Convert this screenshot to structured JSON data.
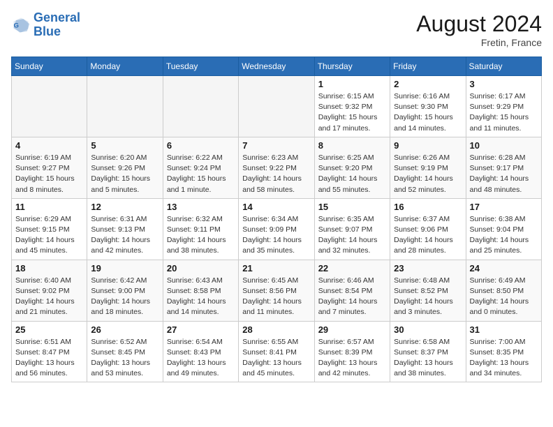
{
  "logo": {
    "text_general": "General",
    "text_blue": "Blue"
  },
  "header": {
    "month": "August 2024",
    "location": "Fretin, France"
  },
  "days_of_week": [
    "Sunday",
    "Monday",
    "Tuesday",
    "Wednesday",
    "Thursday",
    "Friday",
    "Saturday"
  ],
  "weeks": [
    [
      {
        "day": "",
        "info": ""
      },
      {
        "day": "",
        "info": ""
      },
      {
        "day": "",
        "info": ""
      },
      {
        "day": "",
        "info": ""
      },
      {
        "day": "1",
        "info": "Sunrise: 6:15 AM\nSunset: 9:32 PM\nDaylight: 15 hours and 17 minutes."
      },
      {
        "day": "2",
        "info": "Sunrise: 6:16 AM\nSunset: 9:30 PM\nDaylight: 15 hours and 14 minutes."
      },
      {
        "day": "3",
        "info": "Sunrise: 6:17 AM\nSunset: 9:29 PM\nDaylight: 15 hours and 11 minutes."
      }
    ],
    [
      {
        "day": "4",
        "info": "Sunrise: 6:19 AM\nSunset: 9:27 PM\nDaylight: 15 hours and 8 minutes."
      },
      {
        "day": "5",
        "info": "Sunrise: 6:20 AM\nSunset: 9:26 PM\nDaylight: 15 hours and 5 minutes."
      },
      {
        "day": "6",
        "info": "Sunrise: 6:22 AM\nSunset: 9:24 PM\nDaylight: 15 hours and 1 minute."
      },
      {
        "day": "7",
        "info": "Sunrise: 6:23 AM\nSunset: 9:22 PM\nDaylight: 14 hours and 58 minutes."
      },
      {
        "day": "8",
        "info": "Sunrise: 6:25 AM\nSunset: 9:20 PM\nDaylight: 14 hours and 55 minutes."
      },
      {
        "day": "9",
        "info": "Sunrise: 6:26 AM\nSunset: 9:19 PM\nDaylight: 14 hours and 52 minutes."
      },
      {
        "day": "10",
        "info": "Sunrise: 6:28 AM\nSunset: 9:17 PM\nDaylight: 14 hours and 48 minutes."
      }
    ],
    [
      {
        "day": "11",
        "info": "Sunrise: 6:29 AM\nSunset: 9:15 PM\nDaylight: 14 hours and 45 minutes."
      },
      {
        "day": "12",
        "info": "Sunrise: 6:31 AM\nSunset: 9:13 PM\nDaylight: 14 hours and 42 minutes."
      },
      {
        "day": "13",
        "info": "Sunrise: 6:32 AM\nSunset: 9:11 PM\nDaylight: 14 hours and 38 minutes."
      },
      {
        "day": "14",
        "info": "Sunrise: 6:34 AM\nSunset: 9:09 PM\nDaylight: 14 hours and 35 minutes."
      },
      {
        "day": "15",
        "info": "Sunrise: 6:35 AM\nSunset: 9:07 PM\nDaylight: 14 hours and 32 minutes."
      },
      {
        "day": "16",
        "info": "Sunrise: 6:37 AM\nSunset: 9:06 PM\nDaylight: 14 hours and 28 minutes."
      },
      {
        "day": "17",
        "info": "Sunrise: 6:38 AM\nSunset: 9:04 PM\nDaylight: 14 hours and 25 minutes."
      }
    ],
    [
      {
        "day": "18",
        "info": "Sunrise: 6:40 AM\nSunset: 9:02 PM\nDaylight: 14 hours and 21 minutes."
      },
      {
        "day": "19",
        "info": "Sunrise: 6:42 AM\nSunset: 9:00 PM\nDaylight: 14 hours and 18 minutes."
      },
      {
        "day": "20",
        "info": "Sunrise: 6:43 AM\nSunset: 8:58 PM\nDaylight: 14 hours and 14 minutes."
      },
      {
        "day": "21",
        "info": "Sunrise: 6:45 AM\nSunset: 8:56 PM\nDaylight: 14 hours and 11 minutes."
      },
      {
        "day": "22",
        "info": "Sunrise: 6:46 AM\nSunset: 8:54 PM\nDaylight: 14 hours and 7 minutes."
      },
      {
        "day": "23",
        "info": "Sunrise: 6:48 AM\nSunset: 8:52 PM\nDaylight: 14 hours and 3 minutes."
      },
      {
        "day": "24",
        "info": "Sunrise: 6:49 AM\nSunset: 8:50 PM\nDaylight: 14 hours and 0 minutes."
      }
    ],
    [
      {
        "day": "25",
        "info": "Sunrise: 6:51 AM\nSunset: 8:47 PM\nDaylight: 13 hours and 56 minutes."
      },
      {
        "day": "26",
        "info": "Sunrise: 6:52 AM\nSunset: 8:45 PM\nDaylight: 13 hours and 53 minutes."
      },
      {
        "day": "27",
        "info": "Sunrise: 6:54 AM\nSunset: 8:43 PM\nDaylight: 13 hours and 49 minutes."
      },
      {
        "day": "28",
        "info": "Sunrise: 6:55 AM\nSunset: 8:41 PM\nDaylight: 13 hours and 45 minutes."
      },
      {
        "day": "29",
        "info": "Sunrise: 6:57 AM\nSunset: 8:39 PM\nDaylight: 13 hours and 42 minutes."
      },
      {
        "day": "30",
        "info": "Sunrise: 6:58 AM\nSunset: 8:37 PM\nDaylight: 13 hours and 38 minutes."
      },
      {
        "day": "31",
        "info": "Sunrise: 7:00 AM\nSunset: 8:35 PM\nDaylight: 13 hours and 34 minutes."
      }
    ]
  ]
}
